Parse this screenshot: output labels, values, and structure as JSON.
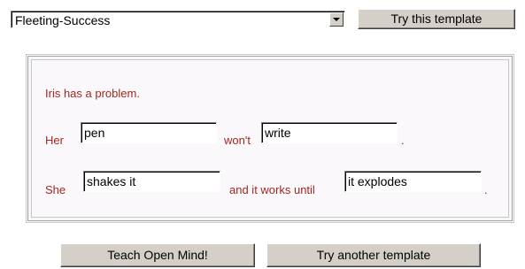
{
  "template_select": {
    "selected": "Fleeting-Success"
  },
  "buttons": {
    "try_this": "Try this template",
    "teach": "Teach Open Mind!",
    "try_another": "Try another template"
  },
  "story": {
    "line1": "Iris has a problem.",
    "line2": {
      "prefix": "Her",
      "field1": "pen",
      "middle": "won't",
      "field2": "write",
      "suffix": "."
    },
    "line3": {
      "prefix": "She",
      "field1": "shakes it",
      "middle": "and it works until",
      "field2": "it explodes",
      "suffix": "."
    }
  },
  "colors": {
    "story_text": "#a0281e",
    "panel_bg": "#fbf8fb",
    "button_face": "#d4d0c8"
  }
}
